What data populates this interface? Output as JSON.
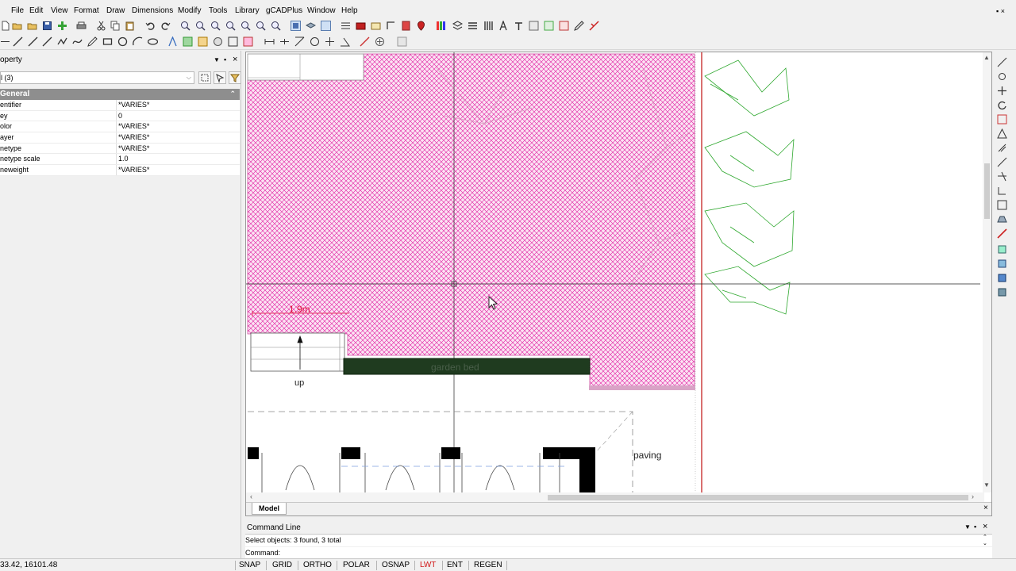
{
  "menu": {
    "items": [
      "File",
      "Edit",
      "View",
      "Format",
      "Draw",
      "Dimensions",
      "Modify",
      "Tools",
      "Library",
      "gCADPlus",
      "Window",
      "Help"
    ],
    "close_glyph": "▪ ×"
  },
  "properties_panel": {
    "title": "operty",
    "selection_value": "l (3)",
    "group_label": "General",
    "rows": [
      {
        "name": "entifier",
        "value": "*VARIES*"
      },
      {
        "name": "ey",
        "value": "0"
      },
      {
        "name": "olor",
        "value": "*VARIES*"
      },
      {
        "name": "ayer",
        "value": "*VARIES*"
      },
      {
        "name": "netype",
        "value": "*VARIES*"
      },
      {
        "name": "netype scale",
        "value": "1.0"
      },
      {
        "name": "neweight",
        "value": "*VARIES*"
      }
    ]
  },
  "drawing": {
    "dimension_label": "1.9m",
    "garden_bed_label": "garden bed",
    "up_label": "up",
    "paving_label": "paving",
    "model_tab": "Model",
    "colors": {
      "hatch": "#e11aa0",
      "hatch_bg": "#fbe3f3",
      "tree": "#2fa82f",
      "red_line": "#c01010",
      "garden_bed": "#1f3b1f",
      "dimension": "#e0123c"
    }
  },
  "command_line": {
    "title": "Command Line",
    "history": "Select objects: 3 found, 3 total",
    "prompt": "Command:"
  },
  "status_bar": {
    "coords": "33.42,  16101.48",
    "buttons": [
      "SNAP",
      "GRID",
      "ORTHO",
      "POLAR",
      "OSNAP",
      "LWT",
      "ENT",
      "REGEN"
    ],
    "active_color": "#d01515"
  }
}
